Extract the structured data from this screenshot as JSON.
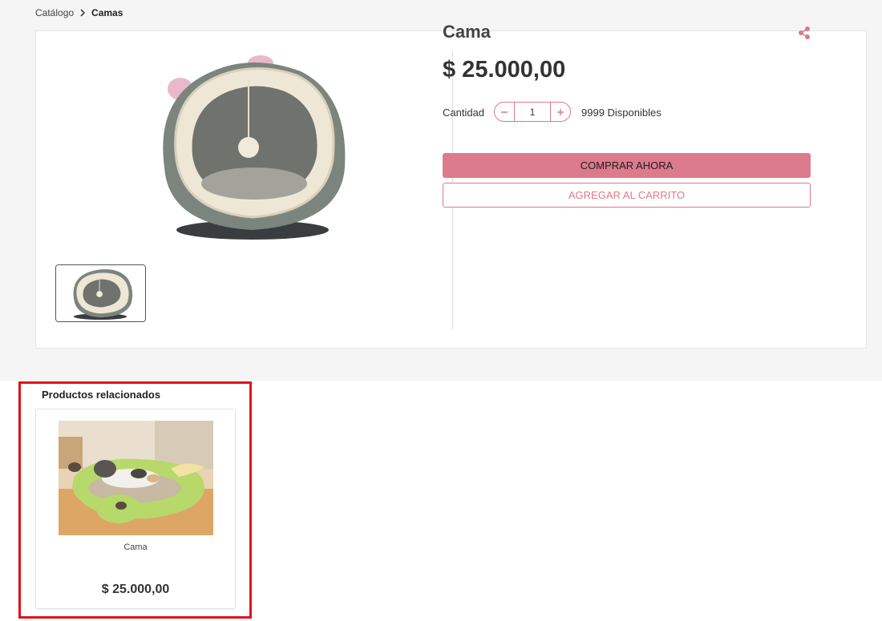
{
  "breadcrumb": {
    "parent": "Catálogo",
    "current": "Camas"
  },
  "product": {
    "title": "Cama",
    "price": "$ 25.000,00",
    "quantity_label": "Cantidad",
    "quantity_value": "1",
    "stock": "9999 Disponibles",
    "buy_now": "COMPRAR AHORA",
    "add_to_cart": "AGREGAR AL CARRITO",
    "share_icon": "share-icon"
  },
  "related": {
    "title": "Productos relacionados",
    "items": [
      {
        "name": "Cama",
        "price": "$ 25.000,00"
      }
    ]
  },
  "colors": {
    "accent": "#dc7b8c",
    "highlight": "#e0131b"
  }
}
